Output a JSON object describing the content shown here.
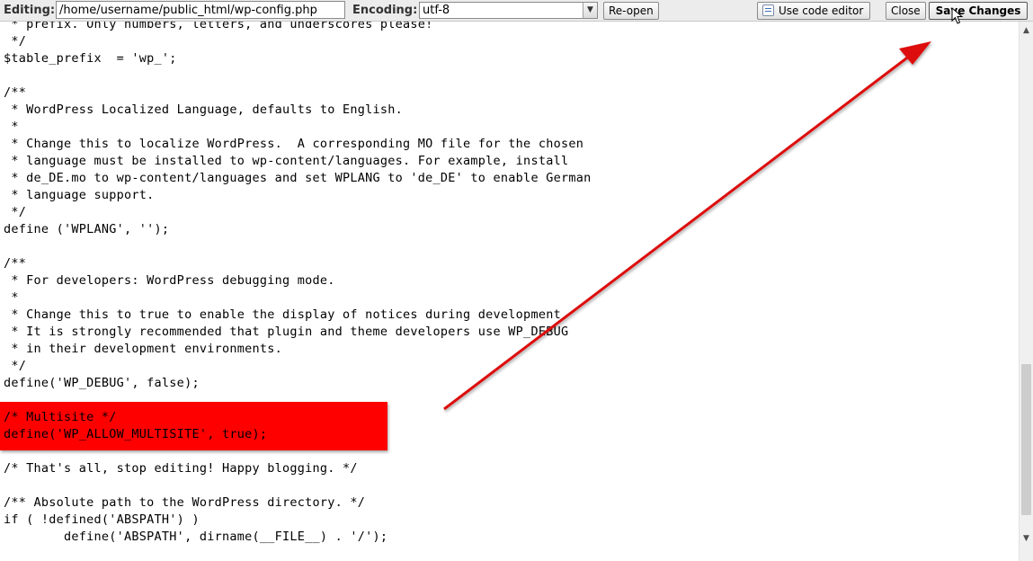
{
  "toolbar": {
    "editing_label": "Editing:",
    "file_path": "/home/username/public_html/wp-config.php",
    "encoding_label": "Encoding:",
    "encoding_value": "utf-8",
    "reopen_label": "Re-open",
    "code_editor_label": "Use code editor",
    "close_label": "Close",
    "save_label": "Save Changes"
  },
  "code": {
    "lines_top": [
      " * prefix. Only numbers, letters, and underscores please!",
      " */",
      "$table_prefix  = 'wp_';",
      "",
      "/**",
      " * WordPress Localized Language, defaults to English.",
      " *",
      " * Change this to localize WordPress.  A corresponding MO file for the chosen",
      " * language must be installed to wp-content/languages. For example, install",
      " * de_DE.mo to wp-content/languages and set WPLANG to 'de_DE' to enable German",
      " * language support.",
      " */",
      "define ('WPLANG', '');",
      "",
      "/**",
      " * For developers: WordPress debugging mode.",
      " *",
      " * Change this to true to enable the display of notices during development.",
      " * It is strongly recommended that plugin and theme developers use WP_DEBUG",
      " * in their development environments.",
      " */",
      "define('WP_DEBUG', false);",
      ""
    ],
    "highlighted_lines": [
      "/* Multisite */",
      "define('WP_ALLOW_MULTISITE', true);"
    ],
    "lines_bottom": [
      "",
      "/* That's all, stop editing! Happy blogging. */",
      "",
      "/** Absolute path to the WordPress directory. */",
      "if ( !defined('ABSPATH') )",
      "\tdefine('ABSPATH', dirname(__FILE__) . '/');"
    ]
  },
  "colors": {
    "highlight": "#ff0000",
    "arrow": "#dd1111"
  },
  "icons": {
    "code_editor": "code-editor-icon",
    "scroll_up": "scroll-up-arrow-icon",
    "scroll_down": "scroll-down-arrow-icon",
    "pointer": "mouse-pointer-icon"
  }
}
